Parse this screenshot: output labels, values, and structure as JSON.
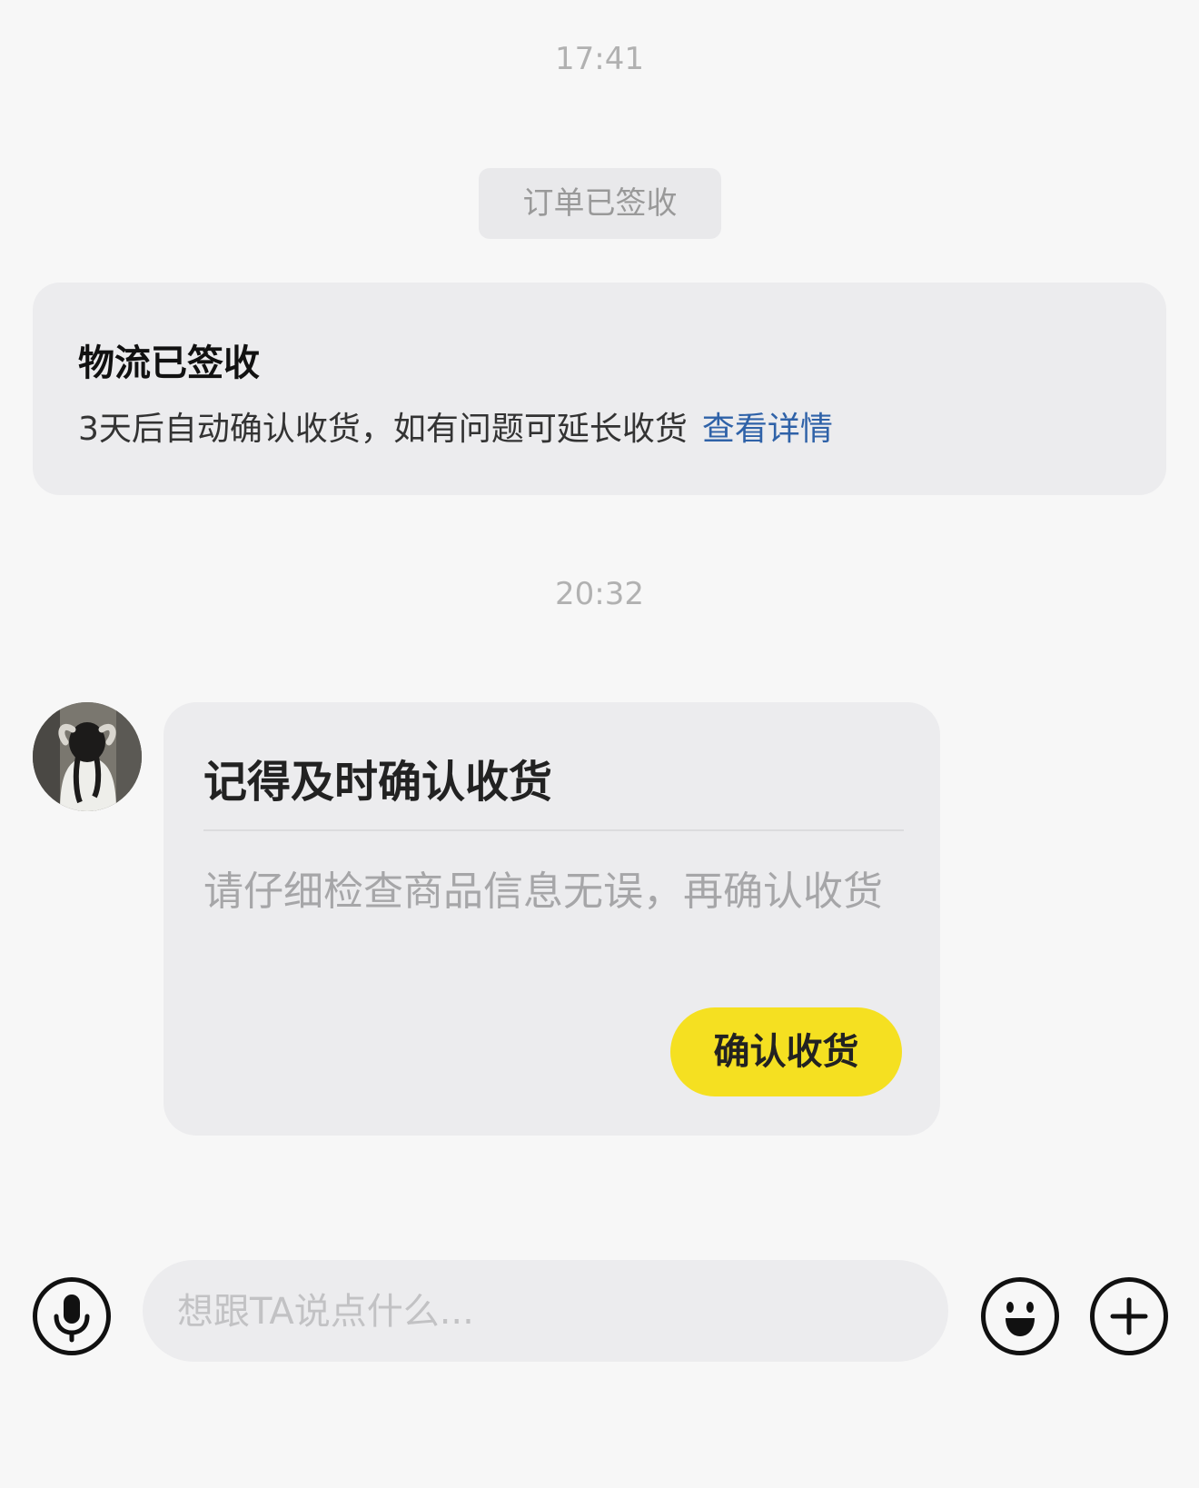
{
  "chat": {
    "timestamp_1": "17:41",
    "system_notice": "订单已签收",
    "logistics_card": {
      "title": "物流已签收",
      "description": "3天后自动确认收货，如有问题可延长收货",
      "link_label": "查看详情"
    },
    "timestamp_2": "20:32",
    "message_card": {
      "title": "记得及时确认收货",
      "body": "请仔细检查商品信息无误，再确认收货",
      "button_label": "确认收货"
    }
  },
  "input_bar": {
    "placeholder": "想跟TA说点什么...",
    "value": "",
    "icons": {
      "voice": "microphone-icon",
      "emoji": "emoji-icon",
      "more": "plus-icon"
    }
  },
  "colors": {
    "background": "#f7f7f7",
    "card": "#ececee",
    "link": "#2f62a8",
    "accent_button": "#f5e021"
  }
}
